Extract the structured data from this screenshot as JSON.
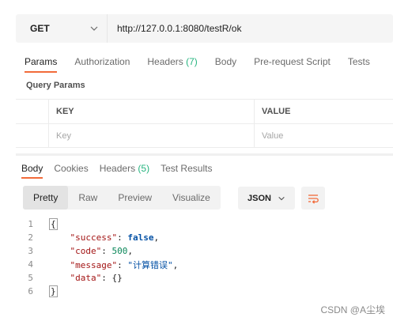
{
  "request": {
    "method": "GET",
    "url": "http://127.0.0.1:8080/testR/ok"
  },
  "request_tabs": [
    {
      "label": "Params",
      "count": ""
    },
    {
      "label": "Authorization",
      "count": ""
    },
    {
      "label": "Headers",
      "count": "(7)"
    },
    {
      "label": "Body",
      "count": ""
    },
    {
      "label": "Pre-request Script",
      "count": ""
    },
    {
      "label": "Tests",
      "count": ""
    }
  ],
  "query_params": {
    "title": "Query Params",
    "key_header": "KEY",
    "value_header": "VALUE",
    "key_placeholder": "Key",
    "value_placeholder": "Value"
  },
  "response_tabs": [
    {
      "label": "Body",
      "count": ""
    },
    {
      "label": "Cookies",
      "count": ""
    },
    {
      "label": "Headers",
      "count": "(5)"
    },
    {
      "label": "Test Results",
      "count": ""
    }
  ],
  "format_buttons": [
    "Pretty",
    "Raw",
    "Preview",
    "Visualize"
  ],
  "format_type": "JSON",
  "code": {
    "line_numbers": [
      "1",
      "2",
      "3",
      "4",
      "5",
      "6"
    ],
    "open_brace": "{",
    "close_brace": "}",
    "success_key": "\"success\"",
    "success_val": "false",
    "code_key": "\"code\"",
    "code_val": "500",
    "message_key": "\"message\"",
    "message_val": "\"计算错误\"",
    "data_key": "\"data\"",
    "data_val": "{}"
  },
  "watermark": "CSDN @A尘埃",
  "colors": {
    "accent": "#f26b3a",
    "count_green": "#26b47f"
  }
}
